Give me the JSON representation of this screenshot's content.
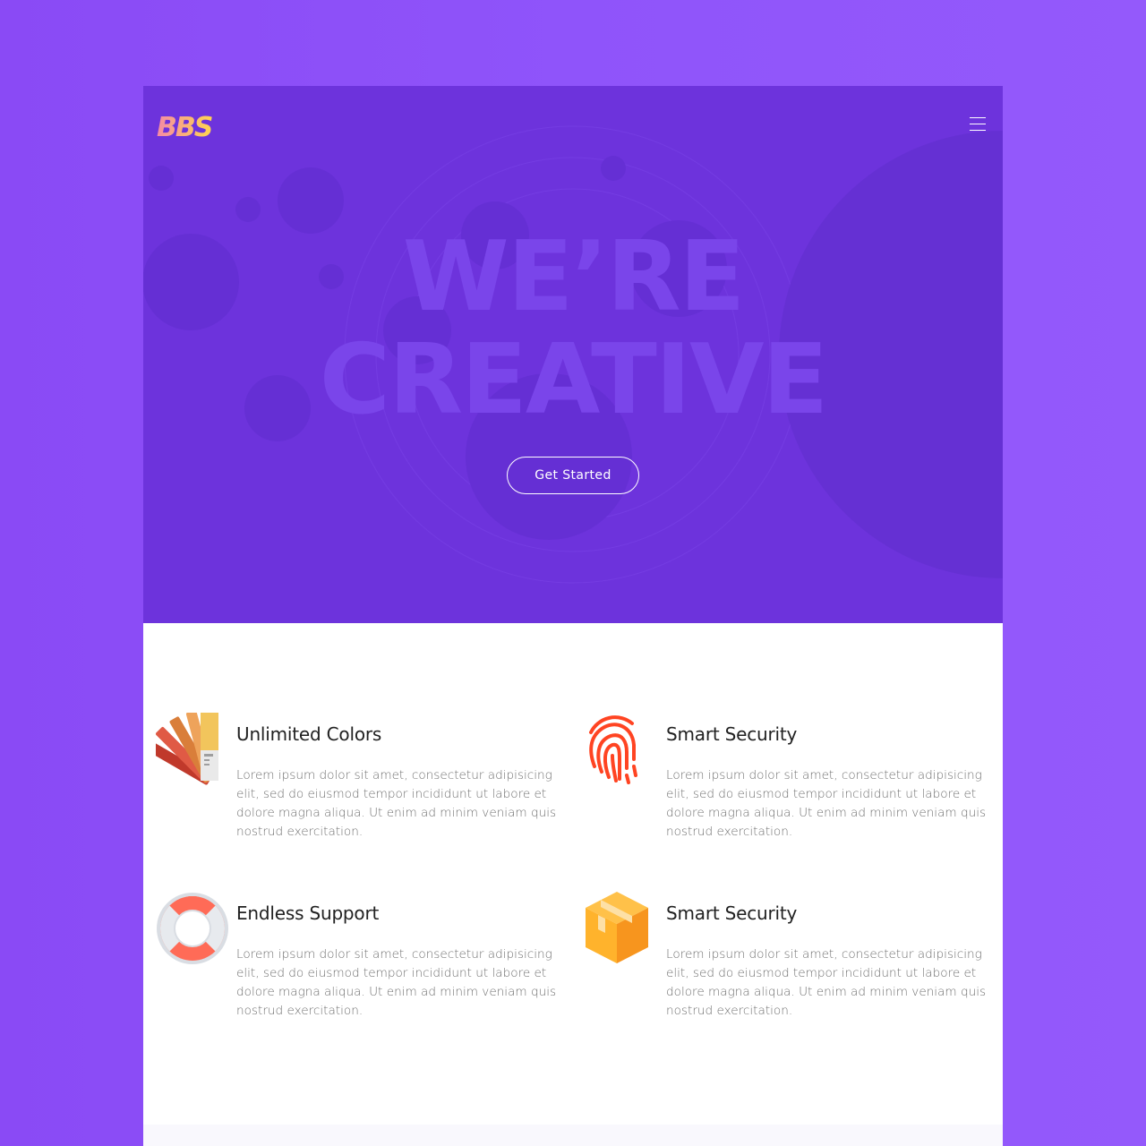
{
  "brand": {
    "logo_text": "BBS"
  },
  "colors": {
    "page_background": "#8b4df6",
    "hero_background": "#6d33dc",
    "hero_title": "#7a45ea",
    "feature_title": "#212121",
    "feature_text": "#6f6f6f",
    "logo_gradient_start": "#f48aa6",
    "logo_gradient_end": "#ffd54f"
  },
  "nav": {
    "menu_icon": "hamburger-menu-icon"
  },
  "hero": {
    "title_line_1": "WE’RE",
    "title_line_2": "CREATIVE",
    "cta_label": "Get Started"
  },
  "features": [
    {
      "icon": "color-swatch-fan-icon",
      "title": "Unlimited Colors",
      "description": "Lorem ipsum dolor sit amet, consectetur adipisicing elit, sed do eiusmod tempor incididunt ut labore et dolore magna aliqua. Ut enim ad minim veniam quis nostrud exercitation."
    },
    {
      "icon": "fingerprint-icon",
      "title": "Smart Security",
      "description": "Lorem ipsum dolor sit amet, consectetur adipisicing elit, sed do eiusmod tempor incididunt ut labore et dolore magna aliqua. Ut enim ad minim veniam quis nostrud exercitation."
    },
    {
      "icon": "lifebuoy-icon",
      "title": "Endless Support",
      "description": "Lorem ipsum dolor sit amet, consectetur adipisicing elit, sed do eiusmod tempor incididunt ut labore et dolore magna aliqua. Ut enim ad minim veniam quis nostrud exercitation."
    },
    {
      "icon": "package-box-icon",
      "title": "Smart Security",
      "description": "Lorem ipsum dolor sit amet, consectetur adipisicing elit, sed do eiusmod tempor incididunt ut labore et dolore magna aliqua. Ut enim ad minim veniam quis nostrud exercitation."
    }
  ]
}
